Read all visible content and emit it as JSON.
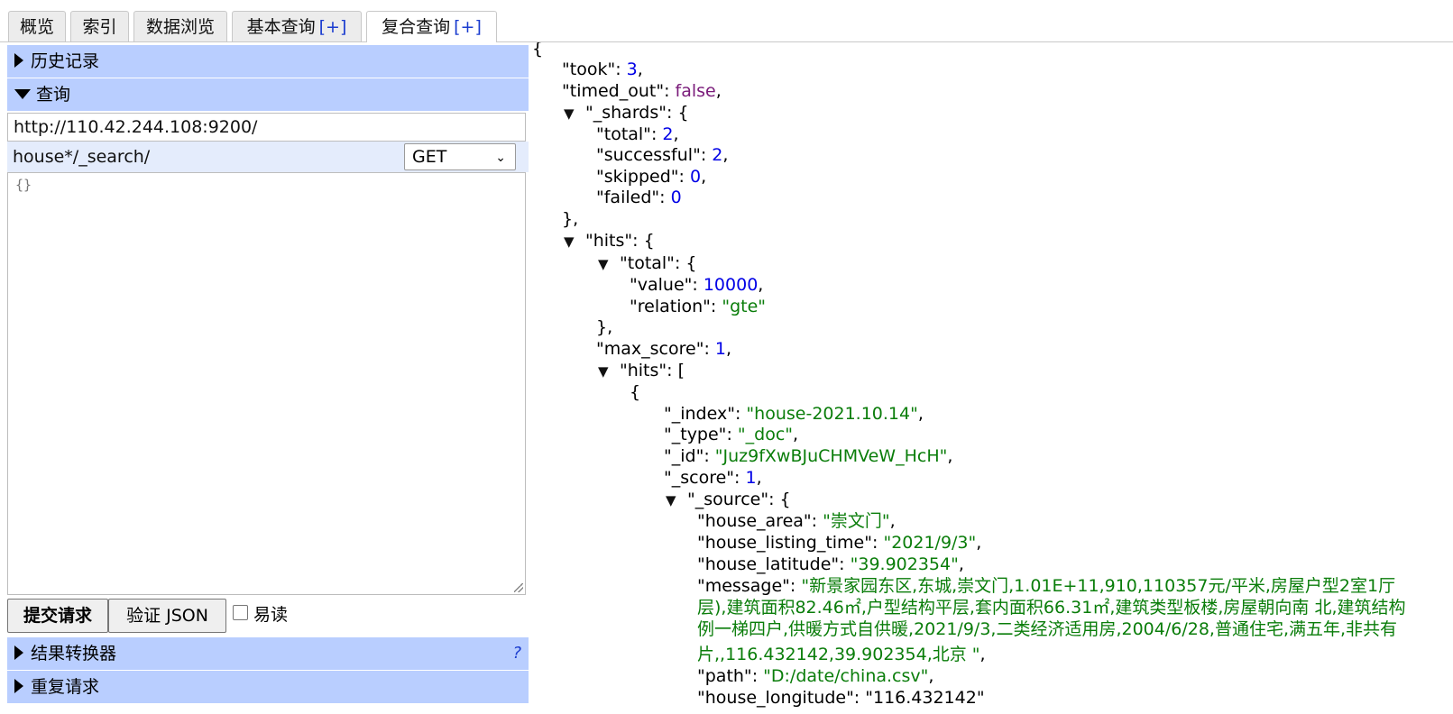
{
  "tabs": [
    {
      "label": "概览",
      "plus": ""
    },
    {
      "label": "索引",
      "plus": ""
    },
    {
      "label": "数据浏览",
      "plus": ""
    },
    {
      "label": "基本查询",
      "plus": "[+]"
    },
    {
      "label": "复合查询",
      "plus": "[+]",
      "active": true
    }
  ],
  "left": {
    "history_label": "历史记录",
    "query_label": "查询",
    "url": "http://110.42.244.108:9200/",
    "path": "house*/_search/",
    "method": "GET",
    "body": "{}",
    "submit_label": "提交请求",
    "validate_label": "验证 JSON",
    "pretty_label": "易读",
    "pretty_checked": false,
    "transformer_label": "结果转换器",
    "help_label": "?",
    "repeat_label": "重复请求"
  },
  "result": {
    "open_brace": "{",
    "took_key": "\"took\"",
    "took": "3",
    "timed_out_key": "\"timed_out\"",
    "timed_out": "false",
    "shards_key": "\"_shards\"",
    "total_key": "\"total\"",
    "shards_total": "2",
    "successful_key": "\"successful\"",
    "successful": "2",
    "skipped_key": "\"skipped\"",
    "skipped": "0",
    "failed_key": "\"failed\"",
    "failed": "0",
    "close_obj_comma": "},",
    "hits_key": "\"hits\"",
    "hits_total_key": "\"total\"",
    "value_key": "\"value\"",
    "value": "10000",
    "relation_key": "\"relation\"",
    "relation": "\"gte\"",
    "max_score_key": "\"max_score\"",
    "max_score": "1",
    "hits_list_key": "\"hits\"",
    "open_bracket": "[",
    "index_key": "\"_index\"",
    "index": "\"house-2021.10.14\"",
    "type_key": "\"_type\"",
    "type": "\"_doc\"",
    "id_key": "\"_id\"",
    "id": "\"Juz9fXwBJuCHMVeW_HcH\"",
    "score_key": "\"_score\"",
    "score": "1",
    "source_key": "\"_source\"",
    "house_area_key": "\"house_area\"",
    "house_area": "\"崇文门\"",
    "listing_time_key": "\"house_listing_time\"",
    "listing_time": "\"2021/9/3\"",
    "latitude_key": "\"house_latitude\"",
    "latitude": "\"39.902354\"",
    "message_key": "\"message\"",
    "message_line1": "\"新景家园东区,东城,崇文门,1.01E+11,910,110357元/平米,房屋户型2室1厅",
    "message_line2": "层),建筑面积82.46㎡,户型结构平层,套内面积66.31㎡,建筑类型板楼,房屋朝向南 北,建筑结构",
    "message_line3": "例一梯四户,供暖方式自供暖,2021/9/3,二类经济适用房,2004/6/28,普通住宅,满五年,非共有",
    "message_line4": "片,,116.432142,39.902354,北京 \"",
    "path_key": "\"path\"",
    "path_val": "\"D:/date/china.csv\"",
    "longitude_partial": "\"house_longitude\": \"116.432142\""
  }
}
